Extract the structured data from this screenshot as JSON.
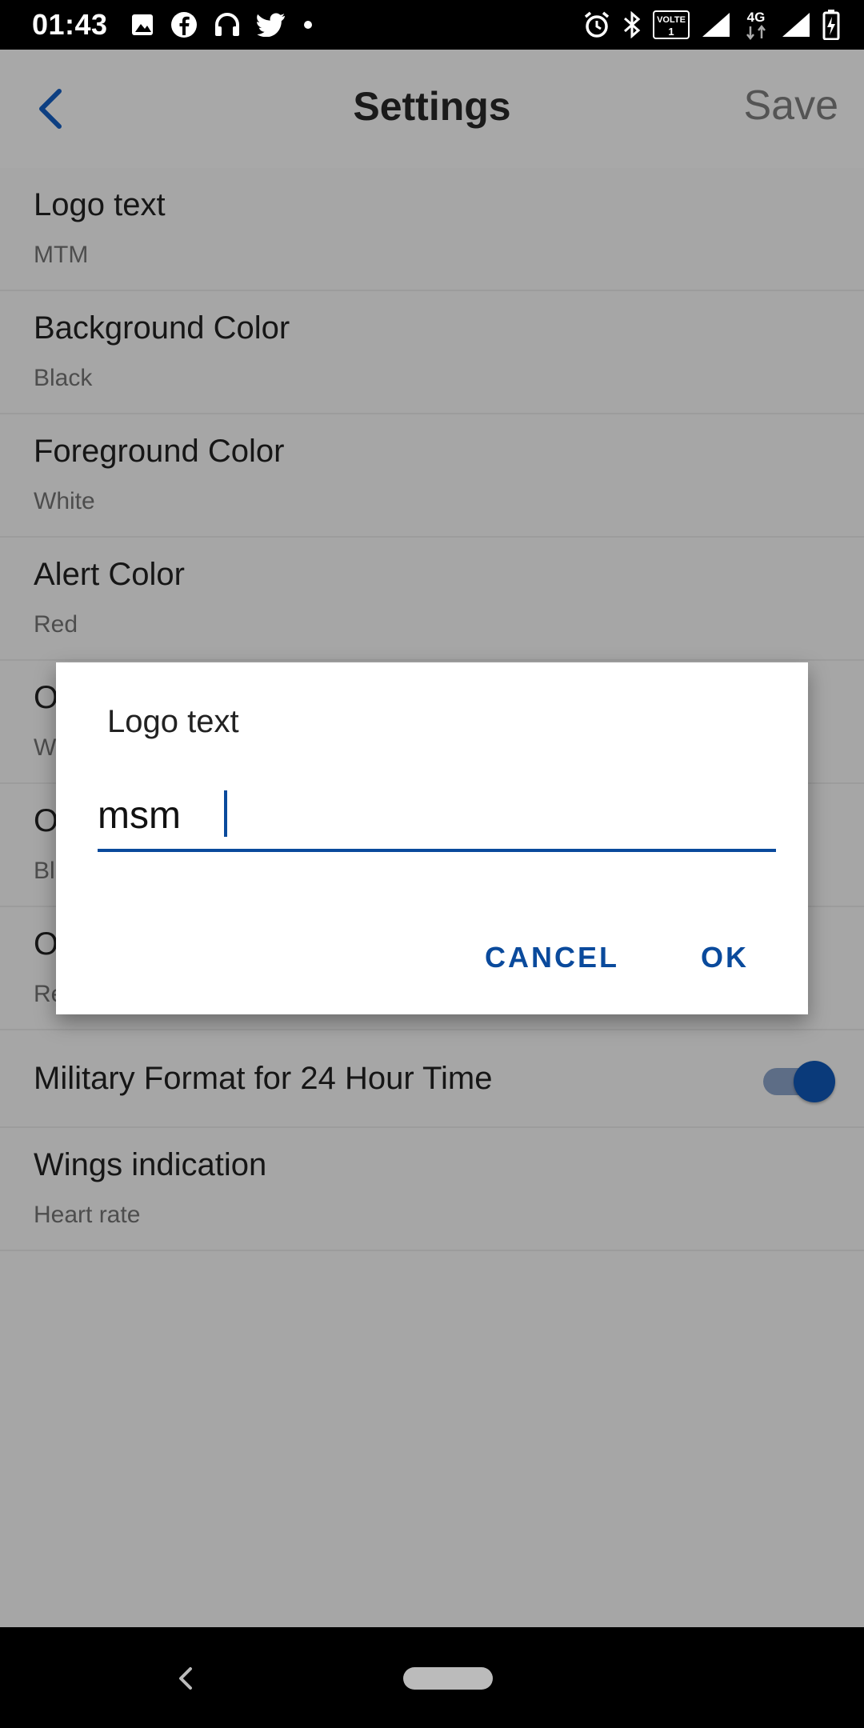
{
  "status_bar": {
    "time": "01:43",
    "left_icons": [
      "image-icon",
      "facebook-icon",
      "headphones-icon",
      "twitter-icon",
      "dot-icon"
    ],
    "right_icons": [
      "alarm-icon",
      "bluetooth-icon",
      "volte-icon",
      "signal-icon",
      "4g-icon",
      "signal-icon",
      "battery-charging-icon"
    ],
    "volte_label": "VOLTE",
    "network_label": "4G"
  },
  "app_bar": {
    "title": "Settings",
    "save_label": "Save",
    "back_icon": "chevron-left-icon"
  },
  "settings": [
    {
      "title": "Logo text",
      "value": "MTM"
    },
    {
      "title": "Background Color",
      "value": "Black"
    },
    {
      "title": "Foreground Color",
      "value": "White"
    },
    {
      "title": "Alert Color",
      "value": "Red"
    },
    {
      "title": "O",
      "value": "W"
    },
    {
      "title": "O",
      "value": "Bl"
    },
    {
      "title": "O",
      "value": "Re"
    }
  ],
  "toggle_setting": {
    "title": "Military Format for 24 Hour Time",
    "enabled": true
  },
  "wings": {
    "title": "Wings indication",
    "value": "Heart rate"
  },
  "dialog": {
    "title": "Logo text",
    "input_value": "msm",
    "cancel_label": "CANCEL",
    "ok_label": "OK"
  },
  "colors": {
    "accent": "#0a4a9c",
    "scrim_background": "#a6a6a6",
    "dialog_background": "#ffffff"
  }
}
